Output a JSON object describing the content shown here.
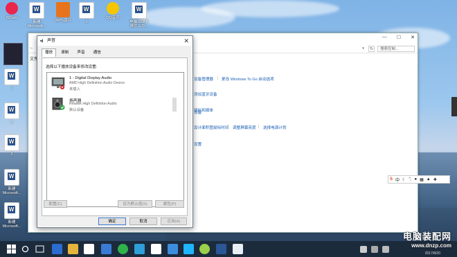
{
  "desktop_icons": [
    {
      "label": "iSCam"
    },
    {
      "label": "新建 Microsoft..."
    },
    {
      "label": "WPS演示"
    },
    {
      "label": "2"
    },
    {
      "label": "QQ音乐"
    },
    {
      "label": "电脑出现卡屏怎么办..."
    },
    {
      "label": "2"
    },
    {
      "label": "2"
    },
    {
      "label": "2"
    },
    {
      "label": "新建 Microsoft..."
    },
    {
      "label": "新建 Microsoft..."
    }
  ],
  "control_panel": {
    "search_placeholder": "搜索控制...",
    "nav_text": "文件",
    "links": [
      {
        "text": "设备管理器"
      },
      {
        "text": "更改 Windows To Go 启动选项"
      },
      {
        "text": "添加蓝牙设备"
      },
      {
        "text": "鼠标和媒体"
      },
      {
        "text": "设备"
      },
      {
        "text": "设计面积图鼠标时间"
      },
      {
        "text": "调整屏幕亮度"
      },
      {
        "text": "选择电源计划"
      },
      {
        "text": "设置"
      }
    ]
  },
  "sound_dialog": {
    "title": "声音",
    "tabs": [
      "播放",
      "录制",
      "声音",
      "通信"
    ],
    "active_tab": "播放",
    "hint": "选择以下播放设备来修改设置:",
    "devices": [
      {
        "name": "1 - Digital Display Audio",
        "desc": "AMD High Definition Audio Device",
        "status": "未插入",
        "status_icon": "red-down-arrow-icon"
      },
      {
        "name": "扬声器",
        "desc": "Realtek High Definition Audio",
        "status": "默认设备",
        "status_icon": "green-check-icon"
      }
    ],
    "buttons": {
      "configure": "配置(C)",
      "set_default": "设为默认值(S)",
      "properties": "属性(P)",
      "ok": "确定",
      "cancel": "取消",
      "apply": "应用(A)"
    }
  },
  "ime_bar": {
    "logo": "S",
    "mode": "中"
  },
  "watermark": {
    "line1": "电脑装配网",
    "line2": "www.dnzp.com"
  },
  "date_text": "2017/8/20",
  "colors": {
    "accent": "#3b7bd6",
    "taskbar": "#1c2b3c",
    "link": "#1a5fb4"
  }
}
